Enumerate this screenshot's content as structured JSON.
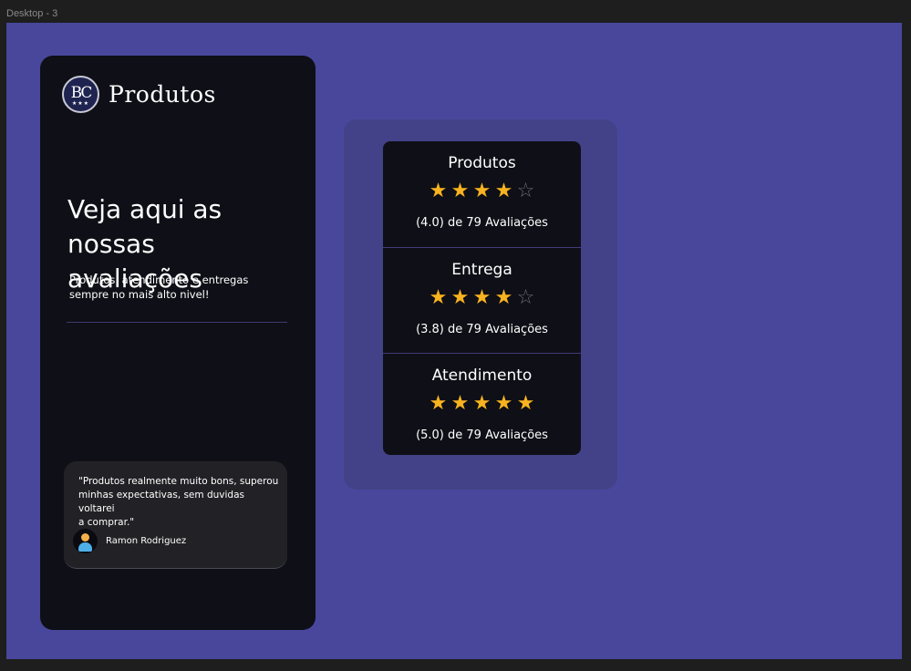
{
  "frame": {
    "label": "Desktop - 3"
  },
  "colors": {
    "canvas": "#48479c",
    "card": "#0f0f17",
    "star_filled": "#f8b31f",
    "star_empty": "#6a6a74"
  },
  "logo": {
    "monogram": "BC",
    "dots": "★★★",
    "title": "Produtos"
  },
  "hero": {
    "headline_line1": "Veja aqui as",
    "headline_line2": "nossas avaliações",
    "subline_line1": "Produtos, atendimento e entregas",
    "subline_line2": "sempre no mais alto nivel!"
  },
  "review": {
    "quote_line1": "\"Produtos realmente muito bons, superou",
    "quote_line2": "minhas expectativas, sem duvidas voltarei",
    "quote_line3": "a comprar.\"",
    "author": "Ramon Rodriguez",
    "avatar_icon": "user-avatar-icon"
  },
  "ratings": [
    {
      "title": "Produtos",
      "stars_filled": 4,
      "stars_total": 5,
      "count_text": "(4.0) de 79 Avaliações"
    },
    {
      "title": "Entrega",
      "stars_filled": 4,
      "stars_total": 5,
      "count_text": "(3.8) de 79 Avaliações"
    },
    {
      "title": "Atendimento",
      "stars_filled": 5,
      "stars_total": 5,
      "count_text": "(5.0) de 79 Avaliações"
    }
  ]
}
